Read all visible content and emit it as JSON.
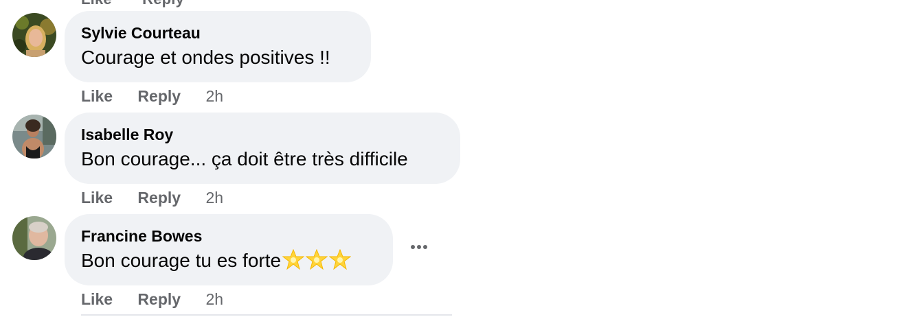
{
  "partial_top": {
    "like": "Like",
    "reply": "Reply"
  },
  "comments": [
    {
      "author": "Sylvie Courteau",
      "text": "Courage et ondes positives !!",
      "like": "Like",
      "reply": "Reply",
      "time": "2h",
      "avatar": "sylvie-avatar"
    },
    {
      "author": "Isabelle Roy",
      "text": "Bon courage... ça doit être très difficile",
      "like": "Like",
      "reply": "Reply",
      "time": "2h",
      "avatar": "isabelle-avatar"
    },
    {
      "author": "Francine Bowes",
      "text": "Bon courage tu es forte",
      "emoji": [
        "glowing-star",
        "glowing-star",
        "glowing-star"
      ],
      "like": "Like",
      "reply": "Reply",
      "time": "2h",
      "avatar": "francine-avatar",
      "more_icon": "more-horizontal-icon"
    }
  ],
  "colors": {
    "bubble": "#f0f2f5",
    "text": "#050505",
    "secondary": "#65676b"
  }
}
